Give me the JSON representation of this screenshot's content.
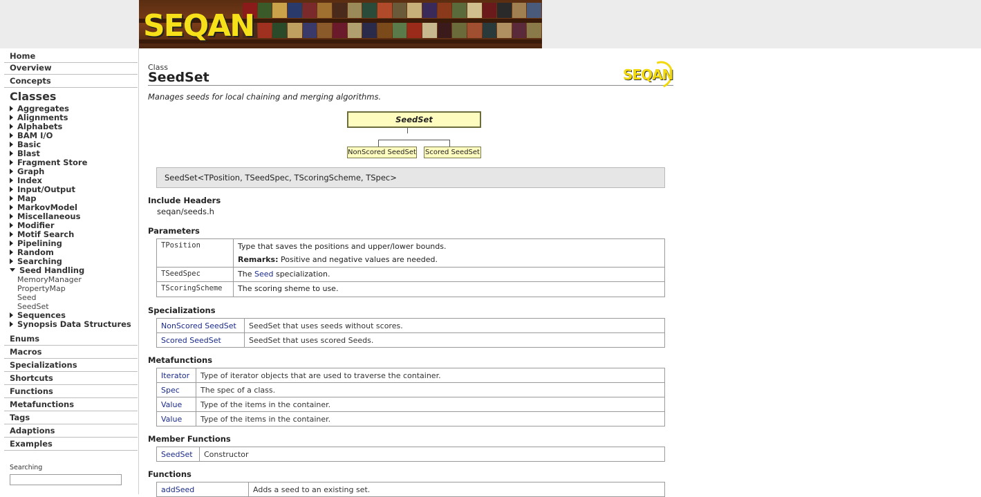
{
  "nav": {
    "top_links": [
      "Home",
      "Overview",
      "Concepts"
    ],
    "classes_heading": "Classes",
    "classes": [
      "Aggregates",
      "Alignments",
      "Alphabets",
      "BAM I/O",
      "Basic",
      "Blast",
      "Fragment Store",
      "Graph",
      "Index",
      "Input/Output",
      "Map",
      "MarkovModel",
      "Miscellaneous",
      "Modifier",
      "Motif Search",
      "Pipelining",
      "Random",
      "Searching",
      "Seed Handling"
    ],
    "seed_handling_items": [
      "MemoryManager",
      "PropertyMap",
      "Seed",
      "SeedSet"
    ],
    "classes_after": [
      "Sequences",
      "Synopsis Data Structures"
    ],
    "bottom_links": [
      "Enums",
      "Macros",
      "Specializations",
      "Shortcuts",
      "Functions",
      "Metafunctions",
      "Tags",
      "Adaptions",
      "Examples"
    ],
    "search_label": "Searching",
    "search_value": ""
  },
  "page": {
    "kind": "Class",
    "name": "SeedSet",
    "description": "Manages seeds for local chaining and merging algorithms.",
    "diagram": {
      "root": "SeedSet",
      "children": [
        "NonScored SeedSet",
        "Scored SeedSet"
      ]
    },
    "signature": "SeedSet<TPosition, TSeedSpec, TScoringScheme, TSpec>",
    "include_headers_title": "Include Headers",
    "include_header": "seqan/seeds.h",
    "parameters_title": "Parameters",
    "parameters": [
      {
        "name": "TPosition",
        "desc": "Type that saves the positions and upper/lower bounds.",
        "remarks_label": "Remarks:",
        "remarks": "Positive and negative values are needed."
      },
      {
        "name": "TSeedSpec",
        "desc_pre": "The ",
        "desc_link": "Seed",
        "desc_post": " specialization."
      },
      {
        "name": "TScoringScheme",
        "desc": "The scoring sheme to use."
      }
    ],
    "specializations_title": "Specializations",
    "specializations": [
      {
        "name": "NonScored SeedSet",
        "desc": "SeedSet that uses seeds without scores."
      },
      {
        "name": "Scored SeedSet",
        "desc": "SeedSet that uses scored Seeds."
      }
    ],
    "metafunctions_title": "Metafunctions",
    "metafunctions": [
      {
        "name": "Iterator",
        "desc": "Type of iterator objects that are used to traverse the container."
      },
      {
        "name": "Spec",
        "desc": "The spec of a class."
      },
      {
        "name": "Value",
        "desc": "Type of the items in the container."
      },
      {
        "name": "Value",
        "desc": "Type of the items in the container."
      }
    ],
    "member_functions_title": "Member Functions",
    "member_functions": [
      {
        "name": "SeedSet",
        "desc": "Constructor"
      }
    ],
    "functions_title": "Functions",
    "functions": [
      {
        "name": "addSeed",
        "desc": "Adds a seed to an existing set."
      }
    ]
  },
  "logo_text": "SEQAN",
  "colors": {
    "link": "#1a2a8a",
    "diagram_fill": "#fffcbf",
    "logo_yellow": "#f6e01a"
  }
}
